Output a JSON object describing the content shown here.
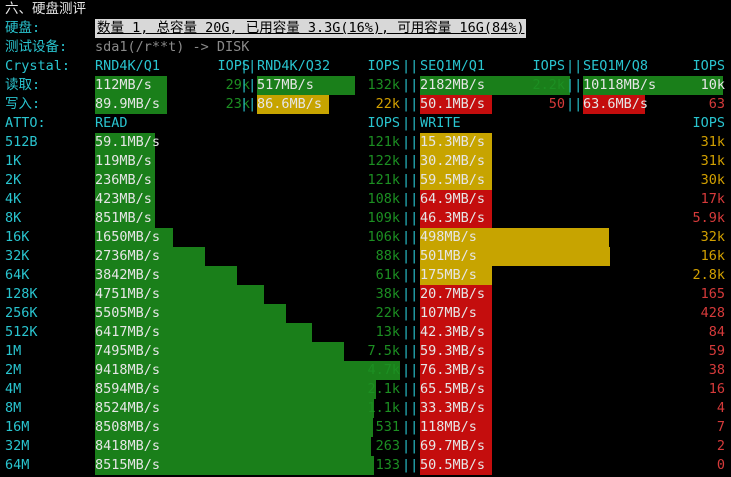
{
  "title": "六、硬盘测评",
  "disk": {
    "label": "硬盘:",
    "info": "数量 1, 总容量 20G, 已用容量 3.3G(16%), 可用容量 16G(84%)"
  },
  "device": {
    "label": "测试设备:",
    "value": "sda1(/r**t) -> DISK"
  },
  "crystal": {
    "label": "Crystal:",
    "headers": [
      "RND4K/Q1",
      "IOPS",
      "RND4K/Q32",
      "IOPS",
      "SEQ1M/Q1",
      "IOPS",
      "SEQ1M/Q8",
      "IOPS"
    ],
    "read_label": "读取:",
    "write_label": "写入:",
    "read": [
      {
        "speed": "112MB/s",
        "iops": "29k"
      },
      {
        "speed": "517MB/s",
        "iops": "132k"
      },
      {
        "speed": "2182MB/s",
        "iops": "2.2k"
      },
      {
        "speed": "10118MB/s",
        "iops": "10k"
      }
    ],
    "write": [
      {
        "speed": "89.9MB/s",
        "iops": "23k"
      },
      {
        "speed": "86.6MB/s",
        "iops": "22k"
      },
      {
        "speed": "50.1MB/s",
        "iops": "50"
      },
      {
        "speed": "63.6MB/s",
        "iops": "63"
      }
    ]
  },
  "atto": {
    "label": "ATTO:",
    "read_header": "READ",
    "read_iops_header": "IOPS",
    "write_header": "WRITE",
    "write_iops_header": "IOPS",
    "rows": [
      {
        "size": "512B",
        "read": "59.1MB/s",
        "read_iops": "121k",
        "write": "15.3MB/s",
        "write_iops": "31k"
      },
      {
        "size": "1K",
        "read": "119MB/s",
        "read_iops": "122k",
        "write": "30.2MB/s",
        "write_iops": "31k"
      },
      {
        "size": "2K",
        "read": "236MB/s",
        "read_iops": "121k",
        "write": "59.5MB/s",
        "write_iops": "30k"
      },
      {
        "size": "4K",
        "read": "423MB/s",
        "read_iops": "108k",
        "write": "64.9MB/s",
        "write_iops": "17k"
      },
      {
        "size": "8K",
        "read": "851MB/s",
        "read_iops": "109k",
        "write": "46.3MB/s",
        "write_iops": "5.9k"
      },
      {
        "size": "16K",
        "read": "1650MB/s",
        "read_iops": "106k",
        "write": "498MB/s",
        "write_iops": "32k"
      },
      {
        "size": "32K",
        "read": "2736MB/s",
        "read_iops": "88k",
        "write": "501MB/s",
        "write_iops": "16k"
      },
      {
        "size": "64K",
        "read": "3842MB/s",
        "read_iops": "61k",
        "write": "175MB/s",
        "write_iops": "2.8k"
      },
      {
        "size": "128K",
        "read": "4751MB/s",
        "read_iops": "38k",
        "write": "20.7MB/s",
        "write_iops": "165"
      },
      {
        "size": "256K",
        "read": "5505MB/s",
        "read_iops": "22k",
        "write": "107MB/s",
        "write_iops": "428"
      },
      {
        "size": "512K",
        "read": "6417MB/s",
        "read_iops": "13k",
        "write": "42.3MB/s",
        "write_iops": "84"
      },
      {
        "size": "1M",
        "read": "7495MB/s",
        "read_iops": "7.5k",
        "write": "59.3MB/s",
        "write_iops": "59"
      },
      {
        "size": "2M",
        "read": "9418MB/s",
        "read_iops": "4.7k",
        "write": "76.3MB/s",
        "write_iops": "38"
      },
      {
        "size": "4M",
        "read": "8594MB/s",
        "read_iops": "2.1k",
        "write": "65.5MB/s",
        "write_iops": "16"
      },
      {
        "size": "8M",
        "read": "8524MB/s",
        "read_iops": "1.1k",
        "write": "33.3MB/s",
        "write_iops": "4"
      },
      {
        "size": "16M",
        "read": "8508MB/s",
        "read_iops": "531",
        "write": "118MB/s",
        "write_iops": "7"
      },
      {
        "size": "32M",
        "read": "8418MB/s",
        "read_iops": "263",
        "write": "69.7MB/s",
        "write_iops": "2"
      },
      {
        "size": "64M",
        "read": "8515MB/s",
        "read_iops": "133",
        "write": "50.5MB/s",
        "write_iops": "0"
      }
    ]
  },
  "colors": {
    "background": "#000000",
    "label_cyan": "#29c4cf",
    "bar_green": "#1a7f1a",
    "bar_yellow": "#c7a400",
    "bar_red": "#c40d0d",
    "iops_green": "#1c8f22",
    "iops_amber": "#d2a000",
    "iops_red": "#d63a3a"
  }
}
